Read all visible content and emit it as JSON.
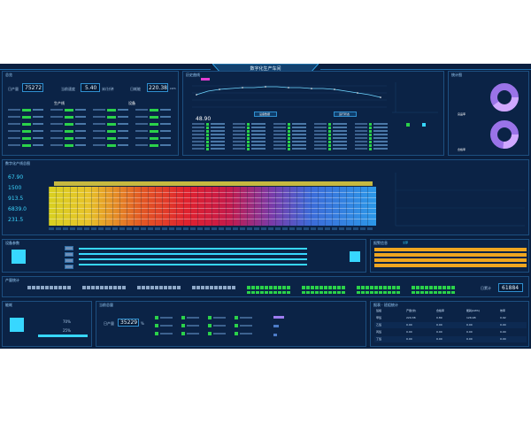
{
  "app": {
    "title": "数字化生产车间"
  },
  "overview": {
    "title": "总览",
    "stat1_label": "日产量",
    "stat1_value": "75272",
    "stat2_label": "当前速度",
    "stat2_value": "5.40",
    "stat2_unit": "米/分钟",
    "stat3_label": "日耗能",
    "stat3_value": "220.38",
    "stat3_unit": "kWh",
    "tag1": "生产线",
    "tag2": "设备"
  },
  "quality": {
    "title": "质量与检测"
  },
  "trend": {
    "title": "历史曲线",
    "sub1": "设备数据",
    "sub2": "运行状态",
    "value": "48.90"
  },
  "ratio": {
    "title": "统计图",
    "label1": "良品率",
    "label2": "合格率"
  },
  "line": {
    "title": "数字化产线总图",
    "values": [
      "67.90",
      "1500",
      "913.5",
      "6839.0",
      "231.5"
    ]
  },
  "machine": {
    "title": "设备参数"
  },
  "alarm": {
    "title": "报警信息",
    "tab": "全部"
  },
  "production": {
    "title": "产量统计",
    "counter_label": "日累计",
    "counter_value": "61884"
  },
  "energy": {
    "title": "能耗",
    "value1": "70%",
    "value2": "25%"
  },
  "output": {
    "title": "当前总量",
    "label": "日产量",
    "value": "35229",
    "unit": "%"
  },
  "table": {
    "title": "报表 · 班组统计",
    "headers": [
      "班组",
      "产量(米)",
      "合格率",
      "能耗(kWh)",
      "效率"
    ],
    "rows": [
      [
        "甲班",
        "220.38",
        "0.89",
        "126.98",
        "0.92"
      ],
      [
        "乙班",
        "0.00",
        "0.00",
        "0.00",
        "0.00"
      ],
      [
        "丙班",
        "0.00",
        "0.00",
        "0.00",
        "0.00"
      ],
      [
        "丁班",
        "0.00",
        "0.00",
        "0.00",
        "0.00"
      ]
    ]
  },
  "colors": {
    "bg": "#0a1f3f",
    "accent": "#37d7ff",
    "green": "#2bd24a",
    "alarm": "#f0a620"
  }
}
